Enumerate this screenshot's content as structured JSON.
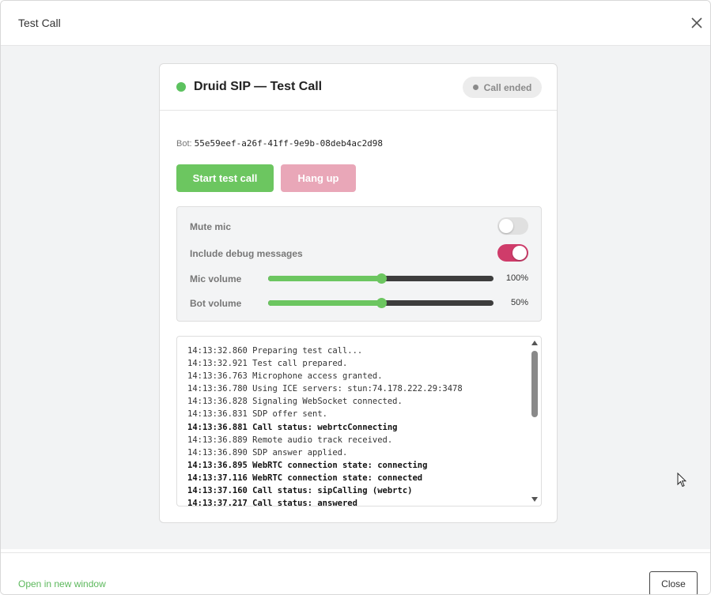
{
  "modal": {
    "title": "Test Call",
    "footer": {
      "open_link": "Open in new window",
      "close_label": "Close"
    }
  },
  "card": {
    "title": "Druid SIP — Test Call",
    "status_pill": "Call ended",
    "status_color": "#5cc25f",
    "bot_label": "Bot:",
    "bot_id": "55e59eef-a26f-41ff-9e9b-08deb4ac2d98",
    "buttons": {
      "start": "Start test call",
      "hangup": "Hang up"
    },
    "settings": {
      "mute_label": "Mute mic",
      "mute_on": false,
      "debug_label": "Include debug messages",
      "debug_on": true,
      "mic_label": "Mic volume",
      "mic_value": "100%",
      "mic_level": 0.5,
      "bot_label": "Bot volume",
      "bot_value": "50%",
      "bot_level": 0.5
    },
    "log": [
      {
        "text": "14:13:32.860 Preparing test call...",
        "bold": false
      },
      {
        "text": "14:13:32.921 Test call prepared.",
        "bold": false
      },
      {
        "text": "14:13:36.763 Microphone access granted.",
        "bold": false
      },
      {
        "text": "14:13:36.780 Using ICE servers: stun:74.178.222.29:3478",
        "bold": false
      },
      {
        "text": "14:13:36.828 Signaling WebSocket connected.",
        "bold": false
      },
      {
        "text": "14:13:36.831 SDP offer sent.",
        "bold": false
      },
      {
        "text": "14:13:36.881 Call status: webrtcConnecting",
        "bold": true
      },
      {
        "text": "14:13:36.889 Remote audio track received.",
        "bold": false
      },
      {
        "text": "14:13:36.890 SDP answer applied.",
        "bold": false
      },
      {
        "text": "14:13:36.895 WebRTC connection state: connecting",
        "bold": true
      },
      {
        "text": "14:13:37.116 WebRTC connection state: connected",
        "bold": true
      },
      {
        "text": "14:13:37.160 Call status: sipCalling (webrtc)",
        "bold": true
      },
      {
        "text": "14:13:37.217 Call status: answered",
        "bold": true
      }
    ]
  },
  "colors": {
    "accent_green": "#6cc660",
    "toggle_on": "#cf3c6a",
    "hangup_disabled": "#e9a7b8"
  }
}
